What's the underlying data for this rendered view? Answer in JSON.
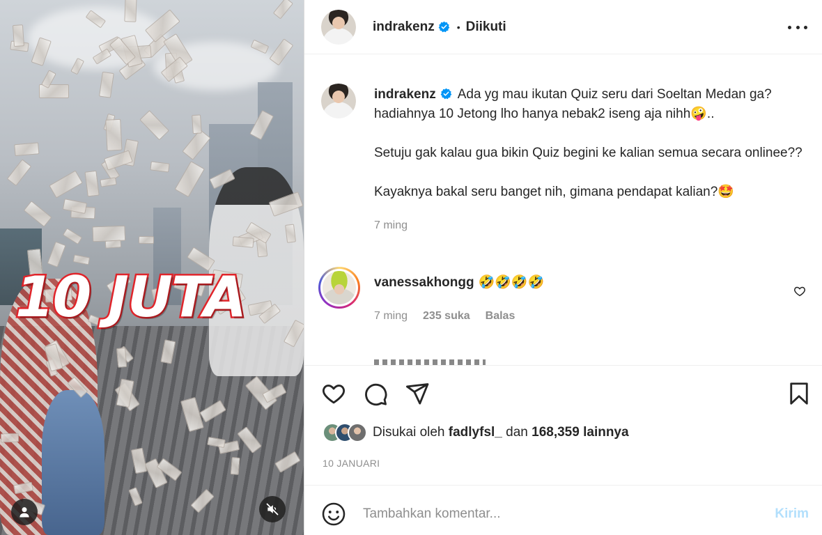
{
  "media": {
    "overlay_text": "10 JUTA",
    "user_tag_icon": "user-tag-icon",
    "mute_icon": "speaker-muted-icon"
  },
  "header": {
    "username": "indrakenz",
    "verified": true,
    "follow_state": "Diikuti",
    "more_icon": "more-horizontal-icon"
  },
  "caption": {
    "username": "indrakenz",
    "paragraphs": [
      "Ada yg mau ikutan Quiz seru dari Soeltan Medan ga? hadiahnya 10 Jetong lho hanya nebak2 iseng aja nihh🤪..",
      "Setuju gak kalau gua bikin Quiz begini ke kalian semua secara onlinee??",
      "Kayaknya bakal seru banget nih, gimana pendapat kalian?🤩"
    ],
    "time": "7 ming"
  },
  "comments": [
    {
      "username": "vanessakhongg",
      "text": "🤣🤣🤣🤣",
      "time": "7 ming",
      "likes": "235 suka",
      "reply_label": "Balas"
    }
  ],
  "actions": {
    "like_icon": "heart-icon",
    "comment_icon": "comment-bubble-icon",
    "share_icon": "paper-plane-icon",
    "save_icon": "bookmark-icon"
  },
  "likes": {
    "prefix": "Disukai oleh",
    "user": "fadlyfsl_",
    "connector": "dan",
    "others": "168,359 lainnya"
  },
  "date": "10 JANUARI",
  "composer": {
    "placeholder": "Tambahkan komentar...",
    "post_label": "Kirim",
    "emoji_icon": "smiley-icon"
  },
  "colors": {
    "verified_blue": "#0095f6",
    "post_button_disabled": "#b2dffc",
    "overlay_stroke": "#e0242a"
  }
}
